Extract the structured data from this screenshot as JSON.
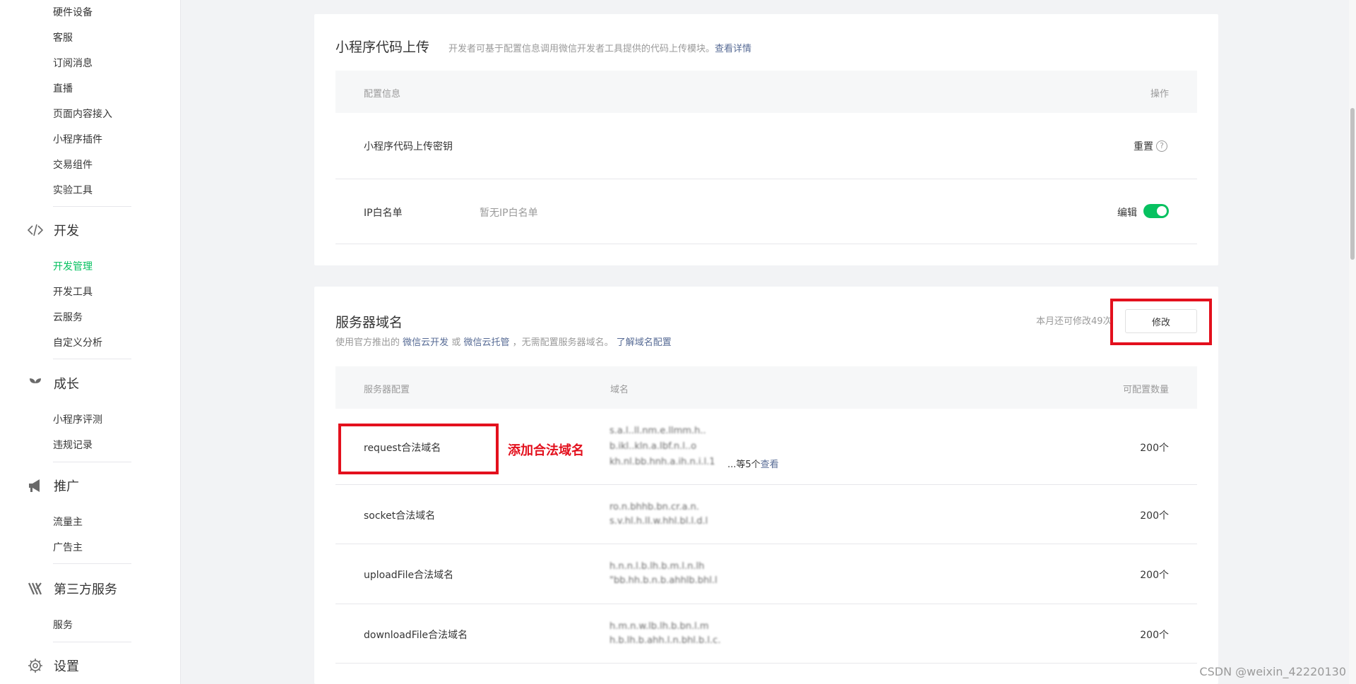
{
  "sidebar": {
    "items_top": [
      {
        "label": "硬件设备"
      },
      {
        "label": "客服"
      },
      {
        "label": "订阅消息"
      },
      {
        "label": "直播"
      },
      {
        "label": "页面内容接入"
      },
      {
        "label": "小程序插件"
      },
      {
        "label": "交易组件"
      },
      {
        "label": "实验工具"
      }
    ],
    "groups": [
      {
        "label": "开发",
        "icon": "code-icon",
        "items": [
          {
            "label": "开发管理",
            "active": true
          },
          {
            "label": "开发工具"
          },
          {
            "label": "云服务"
          },
          {
            "label": "自定义分析"
          }
        ]
      },
      {
        "label": "成长",
        "icon": "sprout-icon",
        "items": [
          {
            "label": "小程序评测"
          },
          {
            "label": "违规记录"
          }
        ]
      },
      {
        "label": "推广",
        "icon": "megaphone-icon",
        "items": [
          {
            "label": "流量主"
          },
          {
            "label": "广告主"
          }
        ]
      },
      {
        "label": "第三方服务",
        "icon": "third-party-icon",
        "items": [
          {
            "label": "服务"
          }
        ]
      },
      {
        "label": "设置",
        "icon": "gear-icon",
        "items": []
      }
    ],
    "active_color": "#07c160"
  },
  "upload_card": {
    "title": "小程序代码上传",
    "desc": "开发者可基于配置信息调用微信开发者工具提供的代码上传模块。",
    "desc_link": "查看详情",
    "col_config": "配置信息",
    "col_action": "操作",
    "rows": [
      {
        "name": "小程序代码上传密钥",
        "action": "重置",
        "help": "?"
      },
      {
        "name": "IP白名单",
        "value": "暂无IP白名单",
        "action": "编辑",
        "toggle_on": true
      }
    ]
  },
  "server_card": {
    "title": "服务器域名",
    "desc_prefix": "使用官方推出的",
    "desc_link1": "微信云开发",
    "desc_or": "或",
    "desc_link2": "微信云托管",
    "desc_mid": "，无需配置服务器域名。",
    "desc_link3": "了解域名配置",
    "quota_text": "本月还可修改49次",
    "modify_button": "修改",
    "col_server": "服务器配置",
    "col_domain": "域名",
    "col_count": "可配置数量",
    "rows": [
      {
        "name": "request合法域名",
        "domains": [
          "s.a.l..ll.nm.e.llmm.h..",
          "b.ikl..kln.a.Ibf.n.l..o",
          "kh.nl.bb.hnh.a.ih.n.i.l.1"
        ],
        "more_text": "...等5个",
        "more_link": "查看",
        "count": "200个"
      },
      {
        "name": "socket合法域名",
        "domains": [
          "ro.n.bhhb.bn.cr.a.n.",
          "s.v.hl.h.lI.w.hhl.bl.l.d.l"
        ],
        "count": "200个"
      },
      {
        "name": "uploadFile合法域名",
        "domains": [
          "h.n.n.l.b.lh.b.m.l.n.lh",
          "\"bb.hh.b.n.b.ahhlb.bhl.l"
        ],
        "count": "200个"
      },
      {
        "name": "downloadFile合法域名",
        "domains": [
          "h.m.n.w.lb.lh.b.bn.l.m",
          "h.b.lh.b.ahh.l.n.bhl.b.l.c."
        ],
        "count": "200个"
      }
    ]
  },
  "annotation": {
    "text": "添加合法域名",
    "color": "#e3101d"
  },
  "watermark": "CSDN @weixin_42220130"
}
